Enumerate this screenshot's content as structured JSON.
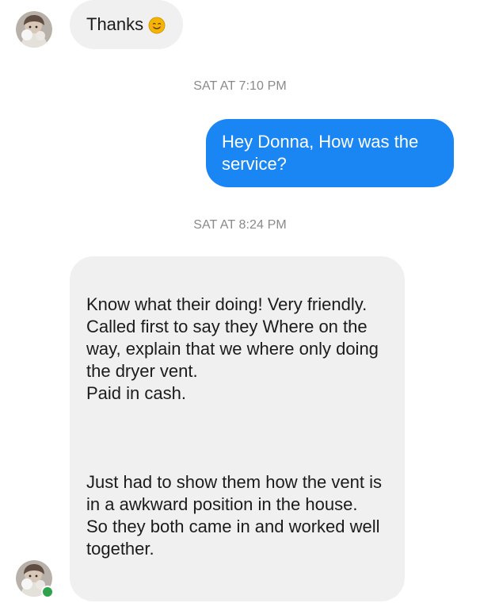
{
  "conversation": {
    "messages": [
      {
        "sender": "contact",
        "text": "Thanks",
        "emoji": "smiling-face-emoji"
      },
      {
        "sender": "me",
        "text": "Hey Donna, How was the service?"
      },
      {
        "sender": "contact",
        "text": "Know what their doing! Very friendly.\nCalled first to say they   Where on the way, explain that we where only doing the dryer vent.\nPaid in cash.\n\n\n\nJust had to show them how the vent is in a awkward position in the house.\nSo they both came in and worked well together."
      }
    ],
    "timestamps": [
      "SAT AT 7:10 PM",
      "SAT AT 8:24 PM"
    ]
  },
  "avatar": {
    "icon": "contact-photo-avatar",
    "online_indicator": "online-status-dot"
  },
  "colors": {
    "outgoing_bubble": "#1a86f4",
    "incoming_bubble": "#f0f0f0",
    "timestamp_text": "#8a8a8a",
    "online_dot": "#31a24c",
    "emoji_face": "#f4b400"
  }
}
